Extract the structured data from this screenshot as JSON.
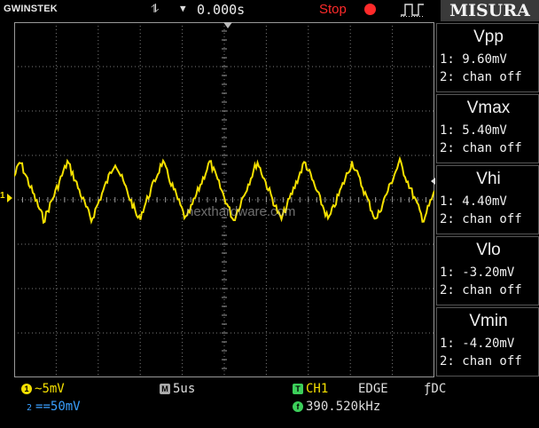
{
  "header": {
    "brand": "GWINSTEK",
    "trigger_edge_icon": "rising-falling-edge-icon",
    "time_offset": "0.000s",
    "run_state": "Stop",
    "run_state_color": "#ff2a2a",
    "measure_menu_title": "MISURA"
  },
  "screen": {
    "channel_marker": "1",
    "watermark": "nexthardware.com",
    "trace_color": "#f5e000"
  },
  "measurements": [
    {
      "name": "Vpp",
      "ch1": "1: 9.60mV",
      "ch2": "2: chan off"
    },
    {
      "name": "Vmax",
      "ch1": "1: 5.40mV",
      "ch2": "2: chan off"
    },
    {
      "name": "Vhi",
      "ch1": "1: 4.40mV",
      "ch2": "2: chan off"
    },
    {
      "name": "Vlo",
      "ch1": "1: -3.20mV",
      "ch2": "2: chan off"
    },
    {
      "name": "Vmin",
      "ch1": "1: -4.20mV",
      "ch2": "2: chan off"
    }
  ],
  "status": {
    "ch1_badge": "1",
    "ch1_coupling": "~",
    "ch1_scale": "5mV",
    "ch2_badge": "2",
    "ch2_coupling": "==",
    "ch2_scale": "50mV",
    "timebase_badge": "M",
    "timebase": "5us",
    "trigger_badge": "T",
    "trigger_source": "CH1",
    "trigger_type": "EDGE",
    "trigger_coupling": "ƒDC",
    "freq_badge": "f",
    "frequency": "390.520kHz"
  },
  "colors": {
    "ch1": "#f5e000",
    "ch2": "#3aa0ff",
    "accent_green": "#3ccf5a",
    "misura_bg": "#3a3a3a"
  }
}
